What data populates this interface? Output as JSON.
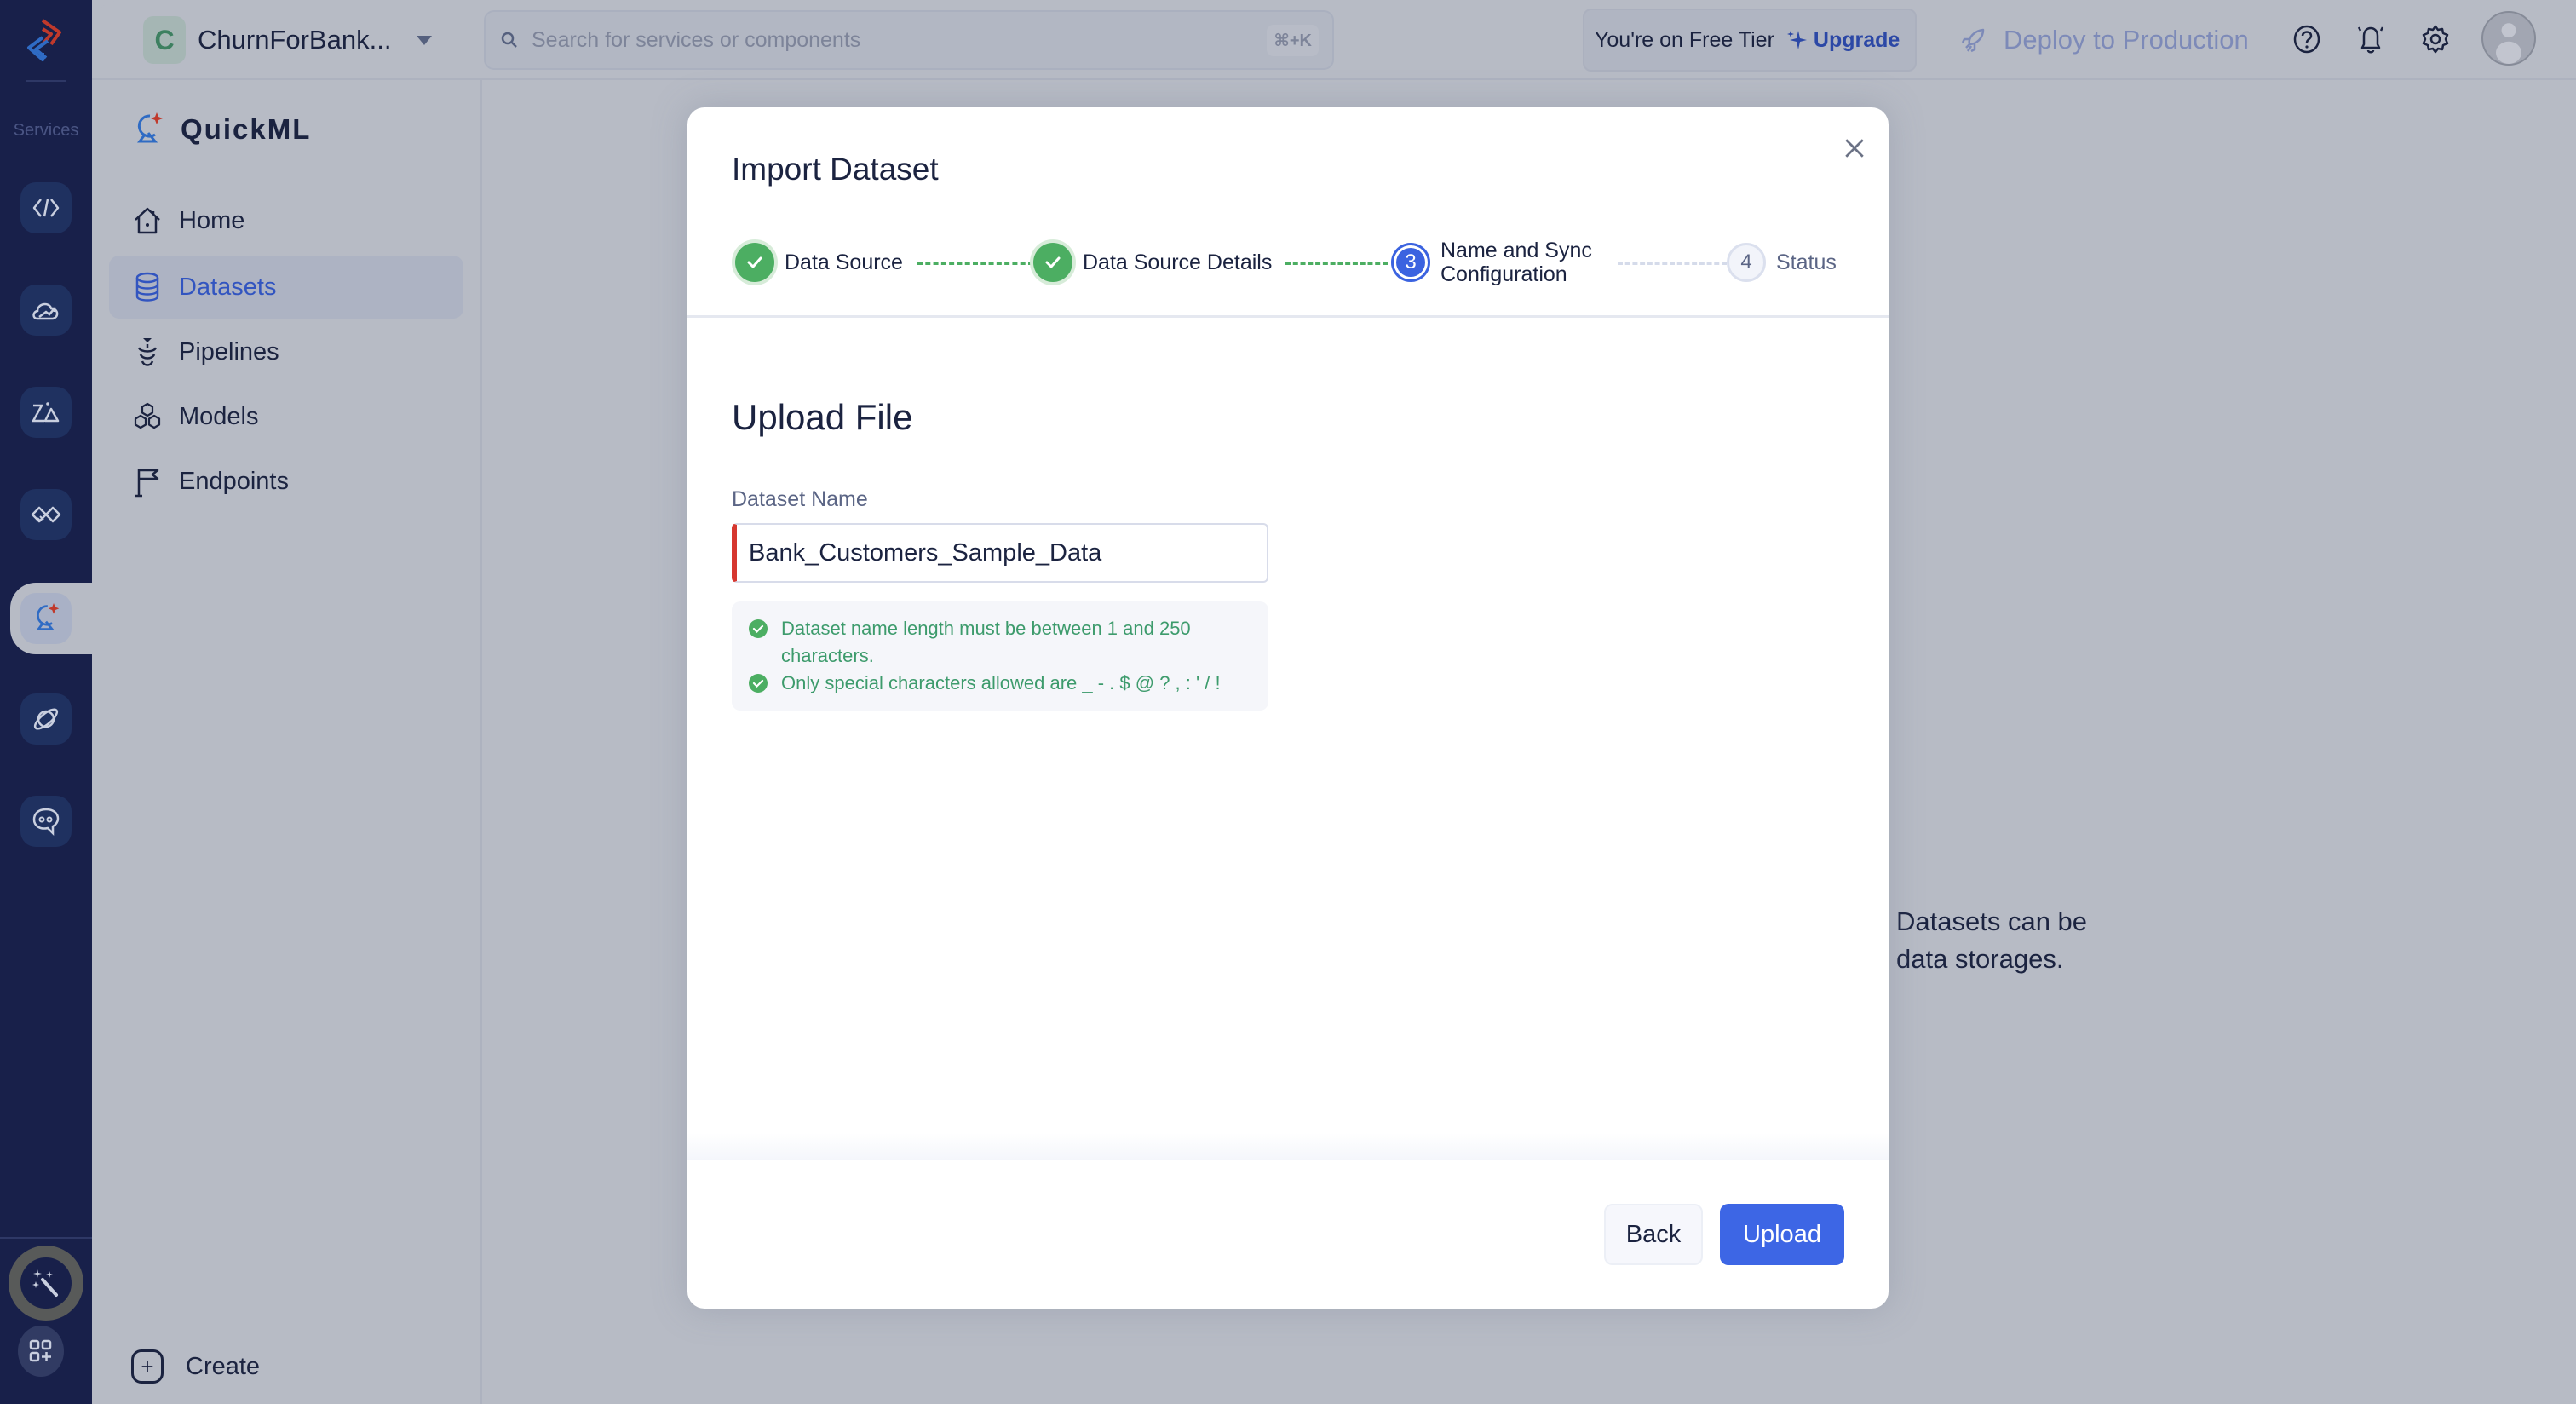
{
  "rail": {
    "label": "Services",
    "items": [
      {
        "icon": "code-brackets-icon",
        "name": "service-code"
      },
      {
        "icon": "cloud-growth-icon",
        "name": "service-cloud"
      },
      {
        "icon": "zia-icon",
        "name": "service-zia"
      },
      {
        "icon": "handshake-icon",
        "name": "service-integrations"
      },
      {
        "icon": "quickml-icon",
        "name": "service-quickml",
        "active": true
      },
      {
        "icon": "planet-icon",
        "name": "service-planet"
      },
      {
        "icon": "chat-bot-icon",
        "name": "service-chatbot"
      }
    ],
    "bottom": [
      {
        "icon": "magic-wand-icon"
      },
      {
        "icon": "apps-add-icon"
      }
    ]
  },
  "topbar": {
    "project_initial": "C",
    "project_name": "ChurnForBank...",
    "search_placeholder": "Search for services or components",
    "search_shortcut": "⌘+K",
    "tier_text": "You're on Free Tier",
    "upgrade_label": "Upgrade",
    "deploy_label": "Deploy to Production"
  },
  "nav": {
    "brand": "QuickML",
    "items": [
      {
        "label": "Home",
        "icon": "home-icon"
      },
      {
        "label": "Datasets",
        "icon": "database-icon",
        "active": true
      },
      {
        "label": "Pipelines",
        "icon": "pipeline-icon"
      },
      {
        "label": "Models",
        "icon": "models-icon"
      },
      {
        "label": "Endpoints",
        "icon": "flag-icon"
      }
    ],
    "create_label": "Create"
  },
  "background_hint": {
    "line1": "Datasets can be",
    "line2": "data storages."
  },
  "modal": {
    "title": "Import Dataset",
    "steps": [
      {
        "number": "1",
        "label": "Data Source",
        "status": "done"
      },
      {
        "number": "2",
        "label": "Data Source Details",
        "status": "done"
      },
      {
        "number": "3",
        "label_line1": "Name and Sync",
        "label_line2": "Configuration",
        "status": "current"
      },
      {
        "number": "4",
        "label": "Status",
        "status": "pending"
      }
    ],
    "section_title": "Upload File",
    "field_label": "Dataset Name",
    "field_value": "Bank_Customers_Sample_Data",
    "rules": [
      {
        "line1": "Dataset name length must be between 1 and 250",
        "line2": "characters.",
        "status": "passed"
      },
      {
        "line1": "Only special characters allowed are _ - . $ @ ? , : ' / !",
        "status": "passed"
      }
    ],
    "back_label": "Back",
    "upload_label": "Upload"
  },
  "colors": {
    "primary": "#3d66e5",
    "success": "#4cae62",
    "error_accent": "#d6372f",
    "rail_bg": "#18204a"
  }
}
